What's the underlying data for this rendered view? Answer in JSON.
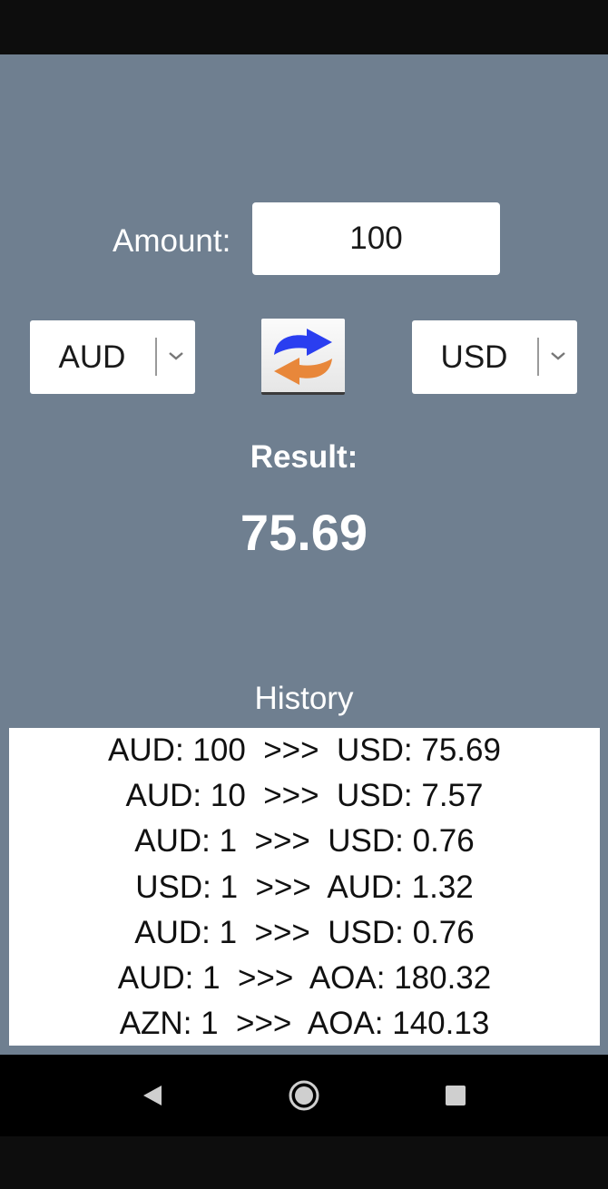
{
  "amount": {
    "label": "Amount:",
    "value": "100"
  },
  "from_currency": {
    "selected": "AUD"
  },
  "to_currency": {
    "selected": "USD"
  },
  "result": {
    "label": "Result:",
    "value": "75.69"
  },
  "history": {
    "title": "History",
    "items": [
      "AUD: 100  >>>  USD: 75.69",
      "AUD: 10  >>>  USD: 7.57",
      "AUD: 1  >>>  USD: 0.76",
      "USD: 1  >>>  AUD: 1.32",
      "AUD: 1  >>>  USD: 0.76",
      "AUD: 1  >>>  AOA: 180.32",
      "AZN: 1  >>>  AOA: 140.13"
    ]
  },
  "icons": {
    "swap": "swap-arrows-icon",
    "dropdown": "chevron-down-icon",
    "back": "back-triangle-icon",
    "home": "home-circle-icon",
    "recents": "recents-square-icon"
  },
  "colors": {
    "background": "#6f7f90",
    "arrow_blue": "#2a3ef0",
    "arrow_orange": "#e8873a"
  }
}
